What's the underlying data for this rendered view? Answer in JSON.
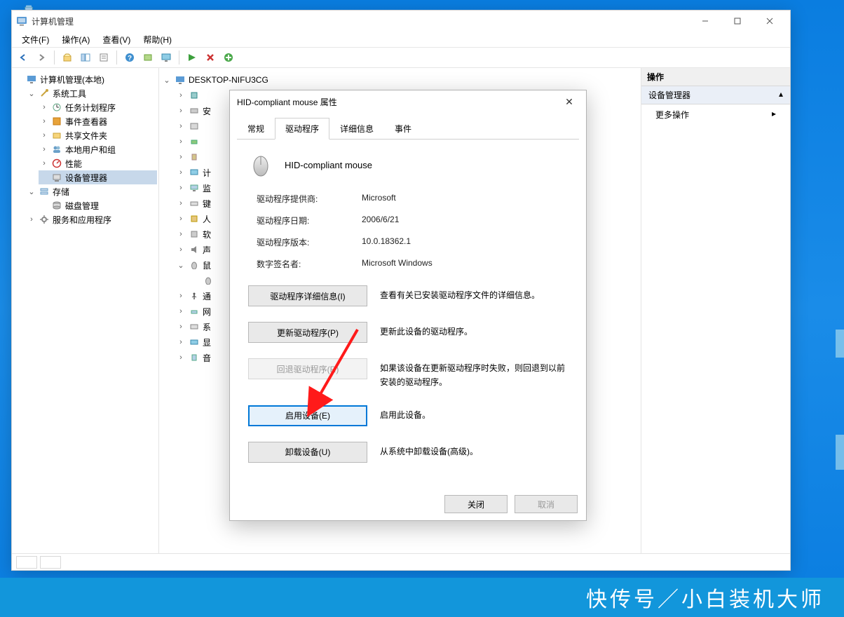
{
  "window": {
    "title": "计算机管理",
    "menu": {
      "file": "文件(F)",
      "action": "操作(A)",
      "view": "查看(V)",
      "help": "帮助(H)"
    }
  },
  "left_tree": {
    "root": "计算机管理(本地)",
    "system_tools": "系统工具",
    "task_scheduler": "任务计划程序",
    "event_viewer": "事件查看器",
    "shared_folders": "共享文件夹",
    "local_users": "本地用户和组",
    "performance": "性能",
    "device_manager": "设备管理器",
    "storage": "存储",
    "disk_mgmt": "磁盘管理",
    "services_apps": "服务和应用程序"
  },
  "dev_root": "DESKTOP-NIFU3CG",
  "right": {
    "header": "操作",
    "section": "设备管理器",
    "more": "更多操作"
  },
  "dialog": {
    "title": "HID-compliant mouse 属性",
    "tabs": {
      "general": "常规",
      "driver": "驱动程序",
      "details": "详细信息",
      "events": "事件"
    },
    "device_name": "HID-compliant mouse",
    "kv": {
      "provider_k": "驱动程序提供商:",
      "provider_v": "Microsoft",
      "date_k": "驱动程序日期:",
      "date_v": "2006/6/21",
      "version_k": "驱动程序版本:",
      "version_v": "10.0.18362.1",
      "signer_k": "数字签名者:",
      "signer_v": "Microsoft Windows"
    },
    "btn_details": "驱动程序详细信息(I)",
    "desc_details": "查看有关已安装驱动程序文件的详细信息。",
    "btn_update": "更新驱动程序(P)",
    "desc_update": "更新此设备的驱动程序。",
    "btn_rollback": "回退驱动程序(R)",
    "desc_rollback": "如果该设备在更新驱动程序时失败，则回退到以前安装的驱动程序。",
    "btn_enable": "启用设备(E)",
    "desc_enable": "启用此设备。",
    "btn_uninstall": "卸载设备(U)",
    "desc_uninstall": "从系统中卸载设备(高级)。",
    "close": "关闭",
    "cancel": "取消"
  },
  "watermark": "快传号／小白装机大师"
}
